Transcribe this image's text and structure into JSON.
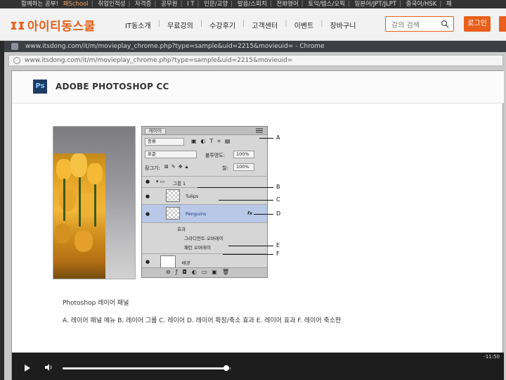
{
  "topstrip": {
    "items": [
      "함께하는 공부!",
      "패School",
      "취업인적성",
      "자격증",
      "공무원",
      "I T",
      "인문/교양",
      "발음/스피치",
      "전화영어",
      "토익/텝스/오픽",
      "일본어/JPT/JLPT",
      "중국어/HSK",
      "채"
    ]
  },
  "header": {
    "logo_text": "아이티동스쿨",
    "nav": [
      "IT동소개",
      "무료강의",
      "수강후기",
      "고객센터",
      "이벤트",
      "장바구니"
    ],
    "search_placeholder": "강의 검색",
    "login_label": "로그인"
  },
  "popup": {
    "title": "www.itsdong.com/it/m/movieplay_chrome.php?type=sample&uid=2215&movieuid= - Chrome",
    "address": "www.itsdong.com/it/m/movieplay_chrome.php?type=sample&uid=2215&movieuid="
  },
  "player": {
    "ps_badge": "Ps",
    "course_title": "ADOBE PHOTOSHOP CC",
    "layers_panel": {
      "tab": "레이어",
      "kind": "종류",
      "blend": "표준",
      "opacity_label": "불투명도:",
      "opacity_value": "100%",
      "lock_label": "잠그기:",
      "fill_label": "칠:",
      "fill_value": "100%",
      "group_name": "그룹 1",
      "layer_tulips": "Tulips",
      "layer_penguins": "Penguins",
      "fx_label": "fx",
      "effects_label": "효과",
      "effect_gradient": "그라디언트 오버레이",
      "effect_pattern": "패턴 오버레이",
      "bg_layer": "배경"
    },
    "callouts": [
      "A",
      "B",
      "C",
      "D",
      "E",
      "F"
    ],
    "caption": "Photoshop 레이어 패널",
    "legend": "A. 레이어 패널 메뉴 B. 레이어 그룹 C. 레이어 D. 레이어 확장/축소 효과 E. 레이어 효과 F. 레이어 축소판",
    "controls": {
      "time": "-11:50",
      "progress_fraction": 0.97
    }
  },
  "colors": {
    "brand_orange": "#e8601c",
    "titlebar": "#3d3f44",
    "controlbar": "#1d1d1d"
  }
}
